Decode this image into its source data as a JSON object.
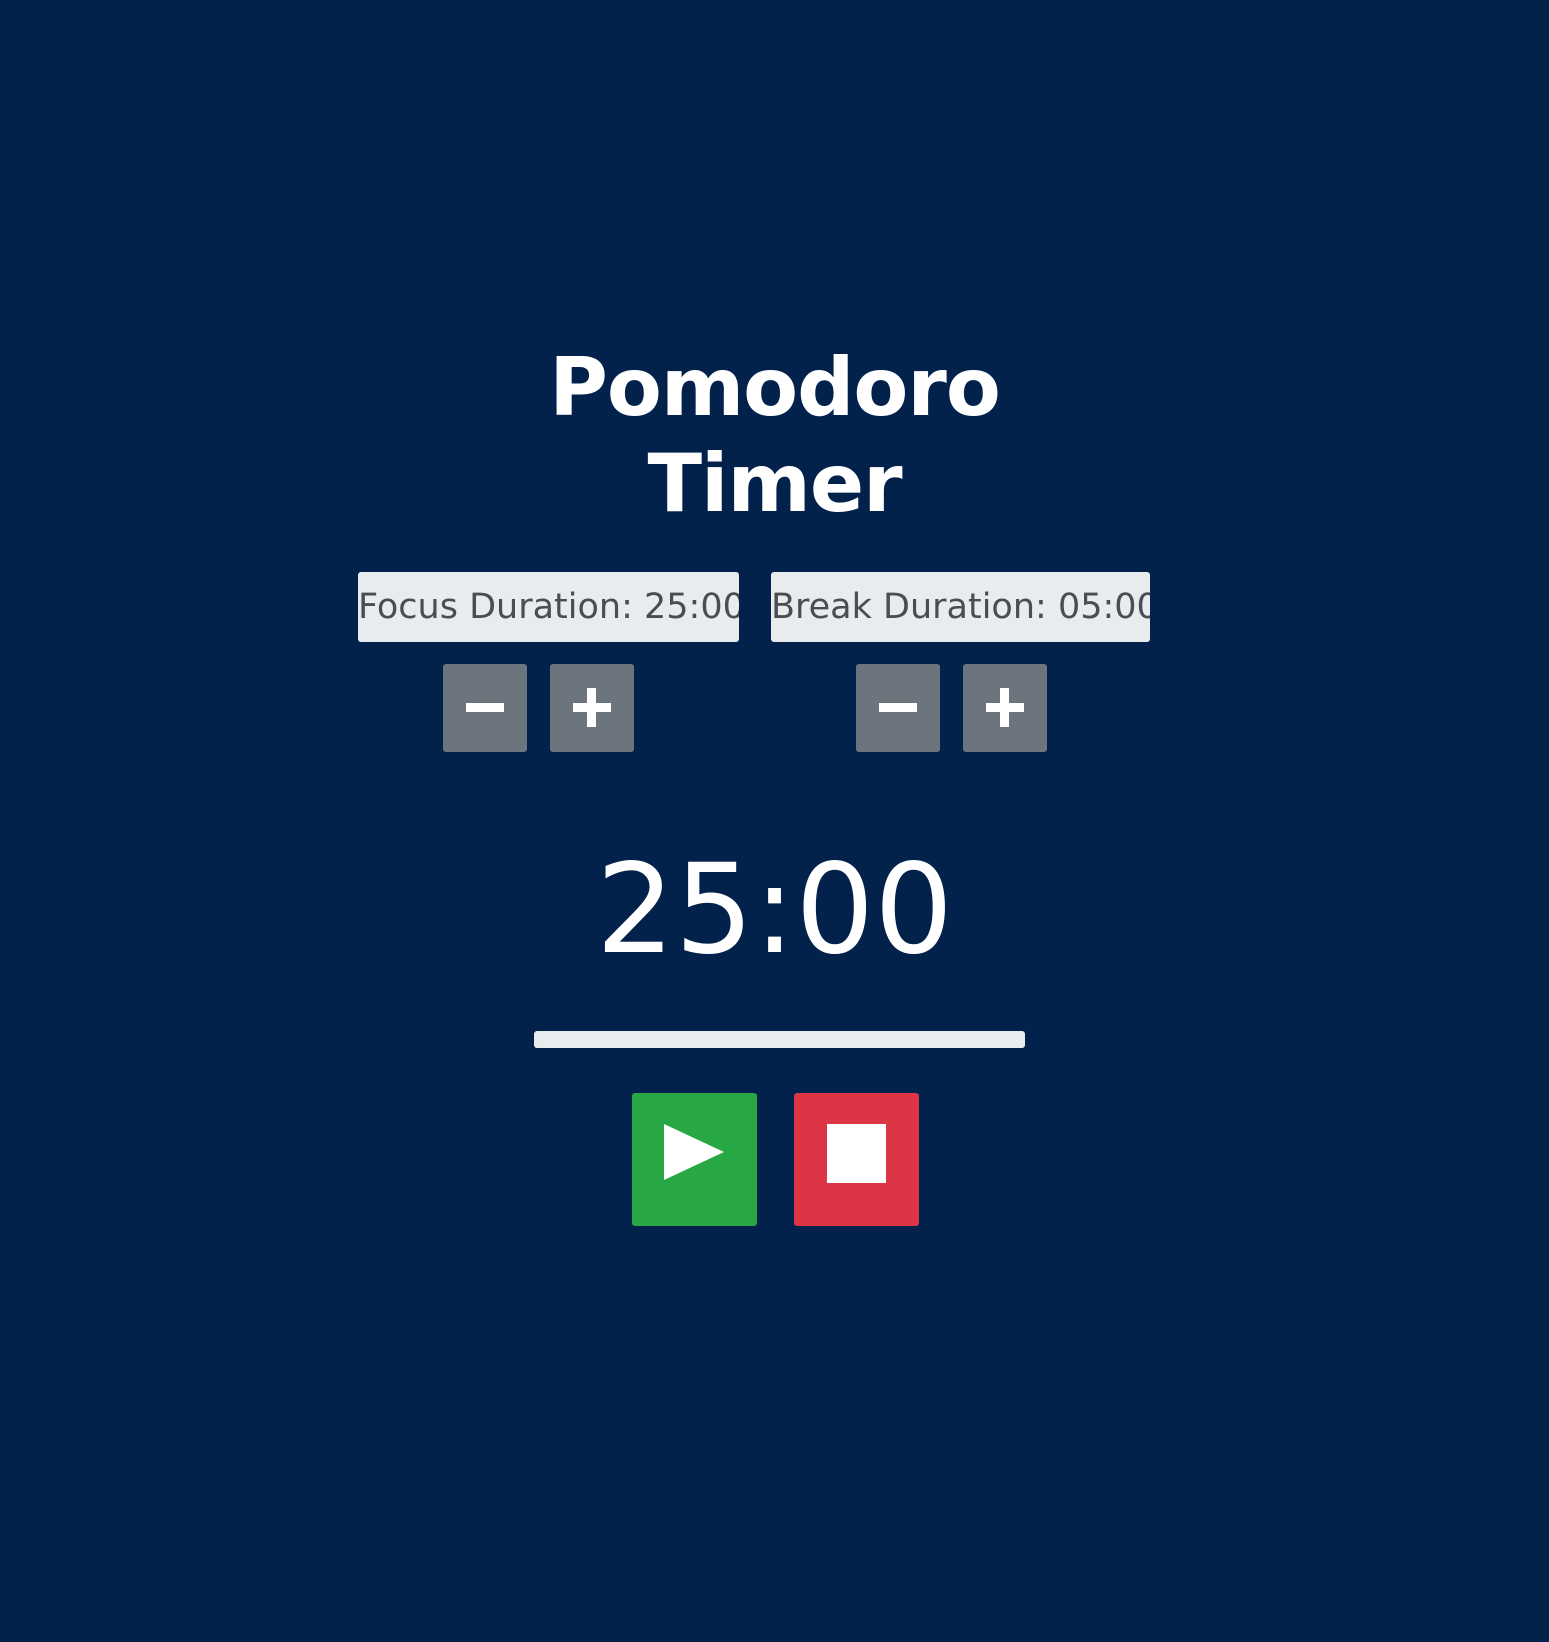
{
  "app": {
    "title_line1": "Pomodoro",
    "title_line2": "Timer"
  },
  "focus": {
    "label": "Focus Duration: 25:00",
    "decrement_icon": "minus-icon",
    "increment_icon": "plus-icon"
  },
  "break": {
    "label": "Break Duration: 05:00",
    "decrement_icon": "minus-icon",
    "increment_icon": "plus-icon"
  },
  "timer": {
    "display": "25:00",
    "progress": 0
  },
  "controls": {
    "start_icon": "play-icon",
    "stop_icon": "stop-icon"
  },
  "colors": {
    "background": "#02224b",
    "start": "#28a745",
    "stop": "#dc3545",
    "stepper": "#6c757d",
    "label_bg": "#e9ecef"
  }
}
